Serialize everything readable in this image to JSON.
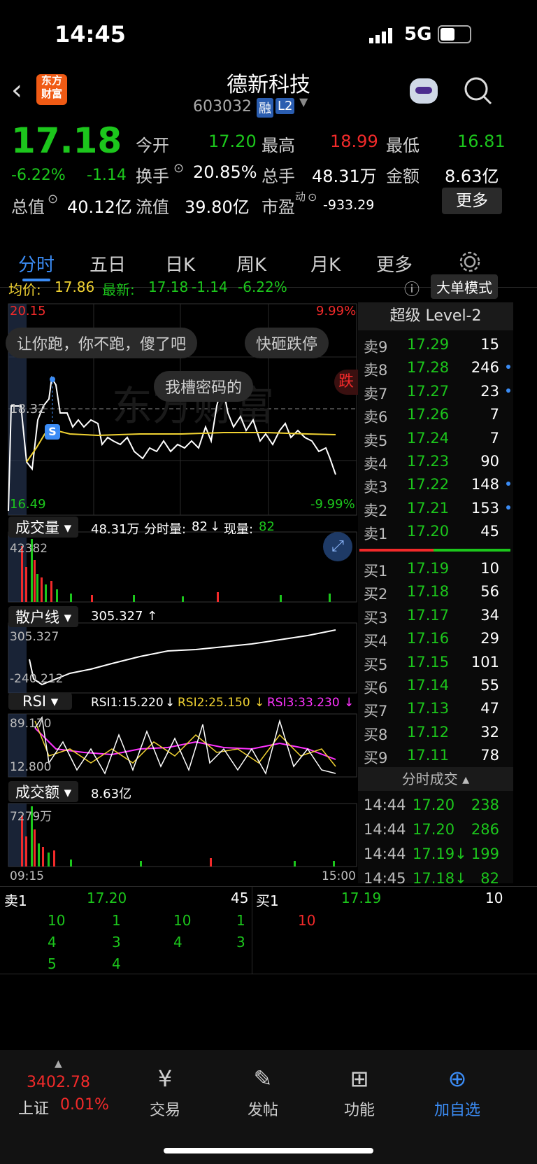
{
  "status": {
    "time": "14:45",
    "network": "5G"
  },
  "header": {
    "logo_line1": "东方",
    "logo_line2": "财富",
    "name": "德新科技",
    "code": "603032",
    "badge_rong": "融",
    "badge_l2": "L2"
  },
  "quote": {
    "price": "17.18",
    "change_pct": "-6.22%",
    "change": "-1.14",
    "open_label": "今开",
    "open": "17.20",
    "high_label": "最高",
    "high": "18.99",
    "low_label": "最低",
    "low": "16.81",
    "turnover_label": "换手",
    "turnover": "20.85%",
    "volume_label": "总手",
    "volume": "48.31万",
    "amount_label": "金额",
    "amount": "8.63亿",
    "mktcap_label": "总值",
    "mktcap": "40.12亿",
    "float_label": "流值",
    "float_val": "39.80亿",
    "pe_label": "市盈",
    "pe_sup": "动",
    "pe": "-933.29",
    "more_button": "更多"
  },
  "tabs": [
    "分时",
    "五日",
    "日K",
    "周K",
    "月K",
    "更多"
  ],
  "avgline": {
    "avg_label": "均价:",
    "avg": "17.86",
    "latest_label": "最新:",
    "latest": "17.18",
    "change": "-1.14",
    "pct": "-6.22%",
    "bigorder": "大单模式"
  },
  "chart": {
    "top_price": "20.15",
    "top_pct": "9.99%",
    "mid_price": "18.32",
    "bottom_price": "16.49",
    "bottom_pct": "-9.99%",
    "danmu1": "让你跑，你不跑，傻了吧",
    "danmu2": "快砸跌停",
    "danmu3": "我槽密码的",
    "danmu4": "跌",
    "s_marker": "S",
    "start_time": "09:15",
    "end_time": "15:00"
  },
  "volume_panel": {
    "title": "成交量",
    "total": "48.31万",
    "period_label": "分时量:",
    "period": "82",
    "now_label": "现量:",
    "now": "82",
    "max": "42382"
  },
  "retail_panel": {
    "title": "散户线",
    "value": "305.327",
    "top": "305.327",
    "bottom": "-240.212"
  },
  "rsi_panel": {
    "title": "RSI",
    "rsi1": "RSI1:15.220",
    "rsi2": "RSI2:25.150",
    "rsi3": "RSI3:33.230",
    "top": "89.170",
    "bottom": "12.800"
  },
  "amount_panel": {
    "title": "成交额",
    "total": "8.63亿",
    "max": "7279万"
  },
  "level2": {
    "title": "超级 Level-2",
    "asks": [
      {
        "label": "卖9",
        "price": "17.29",
        "vol": "15"
      },
      {
        "label": "卖8",
        "price": "17.28",
        "vol": "246"
      },
      {
        "label": "卖7",
        "price": "17.27",
        "vol": "23"
      },
      {
        "label": "卖6",
        "price": "17.26",
        "vol": "7"
      },
      {
        "label": "卖5",
        "price": "17.24",
        "vol": "7"
      },
      {
        "label": "卖4",
        "price": "17.23",
        "vol": "90"
      },
      {
        "label": "卖3",
        "price": "17.22",
        "vol": "148"
      },
      {
        "label": "卖2",
        "price": "17.21",
        "vol": "153"
      },
      {
        "label": "卖1",
        "price": "17.20",
        "vol": "45"
      }
    ],
    "bids": [
      {
        "label": "买1",
        "price": "17.19",
        "vol": "10"
      },
      {
        "label": "买2",
        "price": "17.18",
        "vol": "56"
      },
      {
        "label": "买3",
        "price": "17.17",
        "vol": "34"
      },
      {
        "label": "买4",
        "price": "17.16",
        "vol": "29"
      },
      {
        "label": "买5",
        "price": "17.15",
        "vol": "101"
      },
      {
        "label": "买6",
        "price": "17.14",
        "vol": "55"
      },
      {
        "label": "买7",
        "price": "17.13",
        "vol": "47"
      },
      {
        "label": "买8",
        "price": "17.12",
        "vol": "32"
      },
      {
        "label": "买9",
        "price": "17.11",
        "vol": "78"
      }
    ],
    "trades_title": "分时成交",
    "trades": [
      {
        "time": "14:44",
        "price": "17.20",
        "vol": "238"
      },
      {
        "time": "14:44",
        "price": "17.20",
        "vol": "286"
      },
      {
        "time": "14:44",
        "price": "17.19↓",
        "vol": "199"
      },
      {
        "time": "14:45",
        "price": "17.18↓",
        "vol": "82"
      }
    ]
  },
  "queue": {
    "ask_label": "卖1",
    "ask_price": "17.20",
    "ask_vol": "45",
    "bid_label": "买1",
    "bid_price": "17.19",
    "bid_vol": "10",
    "ask_orders": [
      "10",
      "1",
      "10",
      "1",
      "4",
      "3",
      "4",
      "3",
      "5",
      "4"
    ],
    "bid_orders": [
      "10"
    ]
  },
  "bottom_nav": {
    "index_value": "3402.78",
    "index_name": "上证",
    "index_pct": "0.01%",
    "trade": "交易",
    "post": "发帖",
    "func": "功能",
    "add": "加自选"
  }
}
